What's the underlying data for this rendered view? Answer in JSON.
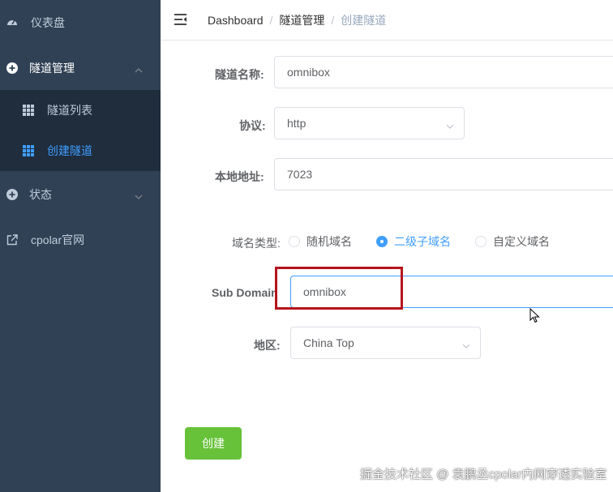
{
  "sidebar": {
    "items": [
      {
        "label": "仪表盘",
        "icon": "dashboard-icon"
      },
      {
        "label": "隧道管理",
        "icon": "plus-circle-icon",
        "expanded": true
      },
      {
        "label": "状态",
        "icon": "plus-circle-icon",
        "expanded": false
      },
      {
        "label": "cpolar官网",
        "icon": "external-link-icon"
      }
    ],
    "submenu": [
      {
        "label": "隧道列表",
        "icon": "grid-icon",
        "active": false
      },
      {
        "label": "创建隧道",
        "icon": "grid-icon",
        "active": true
      }
    ],
    "colors": {
      "background": "#304156",
      "submenu_background": "#1f2d3d",
      "text": "#bfcbd9",
      "active": "#409eff"
    }
  },
  "header": {
    "breadcrumb": [
      "Dashboard",
      "隧道管理",
      "创建隧道"
    ],
    "separator": "/"
  },
  "form": {
    "tunnel_name": {
      "label": "隧道名称:",
      "value": "omnibox"
    },
    "protocol": {
      "label": "协议:",
      "value": "http"
    },
    "local_address": {
      "label": "本地地址:",
      "value": "7023"
    },
    "domain_type": {
      "label": "域名类型:",
      "options": [
        "随机域名",
        "二级子域名",
        "自定义域名"
      ],
      "selected": "二级子域名"
    },
    "sub_domain": {
      "label": "Sub Domain",
      "value": "omnibox"
    },
    "region": {
      "label": "地区:",
      "value": "China Top"
    },
    "create_label": "创建"
  },
  "colors": {
    "primary": "#409eff",
    "success": "#67c23a",
    "highlight": "#b5141c"
  },
  "watermark": "掘金技术社区 @ 袁鹏丞cpolar内网穿透实验室"
}
